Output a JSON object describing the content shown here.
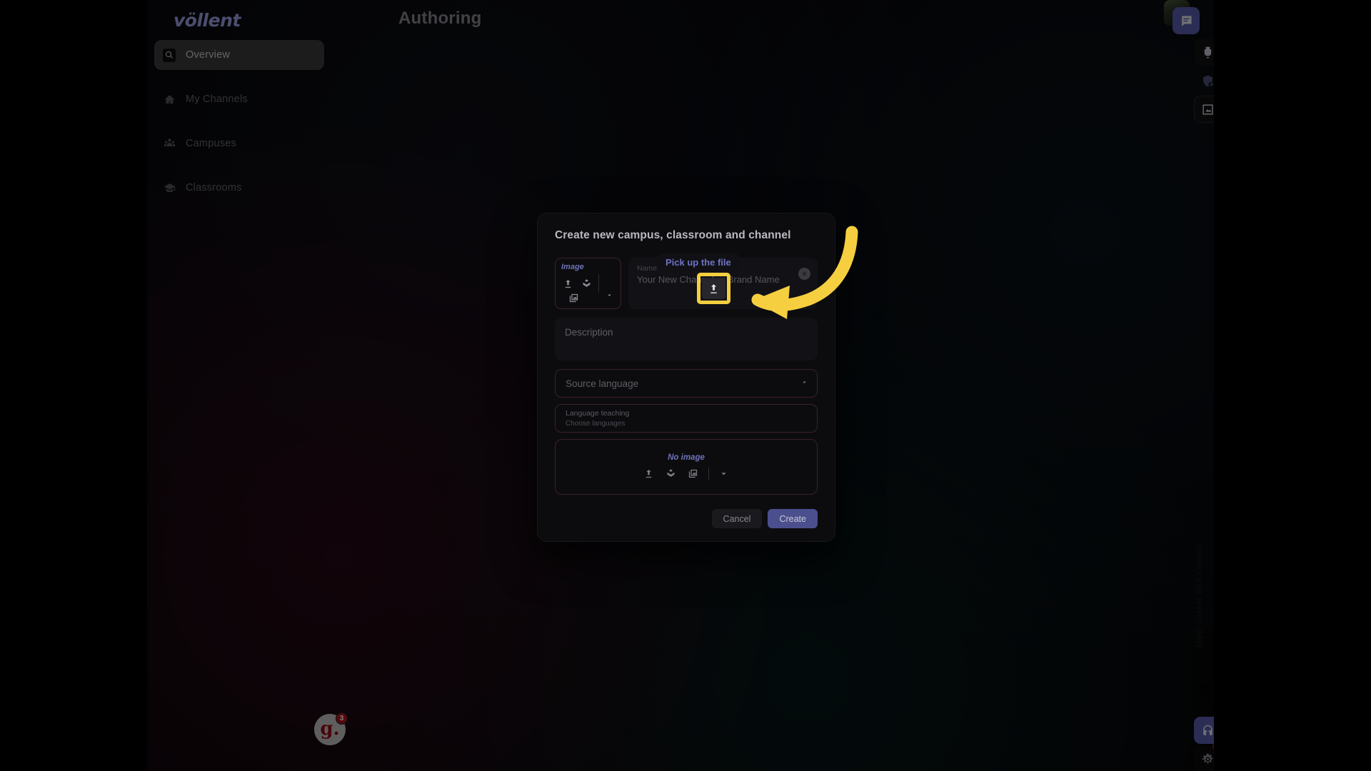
{
  "app": {
    "brand": "völlent",
    "title": "Authoring"
  },
  "sidebar": {
    "items": [
      {
        "label": "Overview",
        "icon": "search-icon",
        "active": true
      },
      {
        "label": "My Channels",
        "icon": "home-icon",
        "active": false
      },
      {
        "label": "Campuses",
        "icon": "people-group-icon",
        "active": false
      },
      {
        "label": "Classrooms",
        "icon": "graduation-cap-icon",
        "active": false
      }
    ]
  },
  "right_rail": {
    "chat": "chat-icon",
    "avatar": "user-avatar",
    "blender": "blender-icon",
    "shield": "shield-user-icon",
    "export": "export-image-icon",
    "face": "face-assistant-icon",
    "gear": "gear-icon",
    "stamp": "stg@ /latest WUI commit"
  },
  "glassdoor": {
    "letter": "g.",
    "badge": "3"
  },
  "modal": {
    "title": "Create new campus, classroom and channel",
    "image_picker": {
      "label": "Image",
      "upload_icon": "upload-icon",
      "library_icon": "open-book-icon",
      "gallery_icon": "gallery-icon",
      "caret_icon": "chevron-down-icon"
    },
    "name": {
      "label": "Name",
      "placeholder": "Your New Channel or Brand Name",
      "value": "",
      "clear_icon": "close-circle-icon"
    },
    "description": {
      "placeholder": "Description",
      "value": ""
    },
    "source_language": {
      "placeholder": "Source language",
      "value": "",
      "caret_icon": "chevron-down-icon"
    },
    "language_teaching": {
      "label": "Language teaching",
      "placeholder": "Choose languages",
      "value": ""
    },
    "image_drop": {
      "status": "No image",
      "upload_icon": "upload-icon",
      "library_icon": "open-book-icon",
      "gallery_icon": "gallery-icon",
      "caret_icon": "chevron-down-icon"
    },
    "actions": {
      "cancel": "Cancel",
      "create": "Create"
    }
  },
  "coach": {
    "tooltip": "Pick up the file",
    "highlight_color": "#f5cf3f",
    "arrow_color": "#f5cf3f"
  },
  "colors": {
    "accent": "#6f72c4",
    "primary_button": "#4b4f8e",
    "highlight": "#f5cf3f",
    "field_border": "#3d2126",
    "badge_red": "#b01319"
  }
}
